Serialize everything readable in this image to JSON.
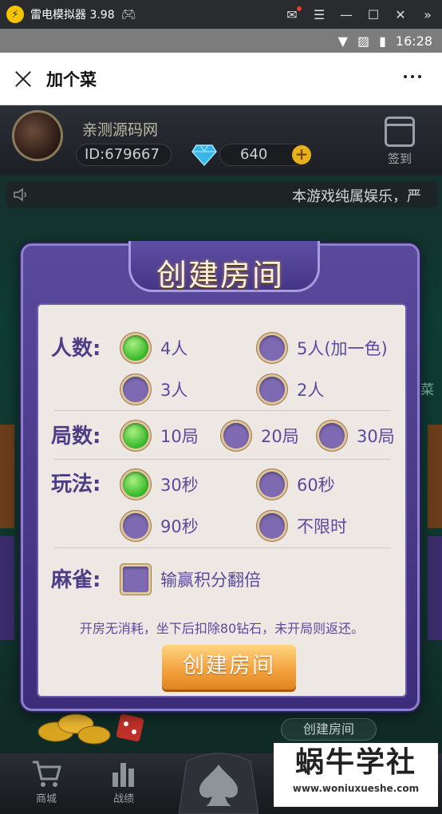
{
  "emulator": {
    "title": "雷电模拟器 3.98"
  },
  "status_bar": {
    "time": "16:28"
  },
  "app": {
    "title": "加个菜"
  },
  "player": {
    "nickname": "亲测源码网",
    "id": "ID:679667",
    "diamonds": "640",
    "signin_label": "签到"
  },
  "marquee": {
    "text": "本游戏纯属娱乐，严"
  },
  "background": {
    "side_text": "菜",
    "create_room_label": "创建房间"
  },
  "nav": {
    "mall": "商城",
    "record": "战绩"
  },
  "dialog": {
    "title": "创建房间",
    "players": {
      "label": "人数:",
      "options": [
        "4人",
        "5人(加一色)",
        "3人",
        "2人"
      ],
      "selected": "4人"
    },
    "rounds": {
      "label": "局数:",
      "options": [
        "10局",
        "20局",
        "30局"
      ],
      "selected": "10局"
    },
    "mode": {
      "label": "玩法:",
      "options": [
        "30秒",
        "60秒",
        "90秒",
        "不限时"
      ],
      "selected": "30秒"
    },
    "mahjong": {
      "label": "麻雀:",
      "checkbox_label": "输赢积分翻倍",
      "checked": false
    },
    "note": "开房无消耗，坐下后扣除80钻石，未开局则返还。",
    "create_button": "创建房间"
  },
  "watermark": {
    "title": "蜗牛学社",
    "url": "www.woniuxueshe.com"
  }
}
